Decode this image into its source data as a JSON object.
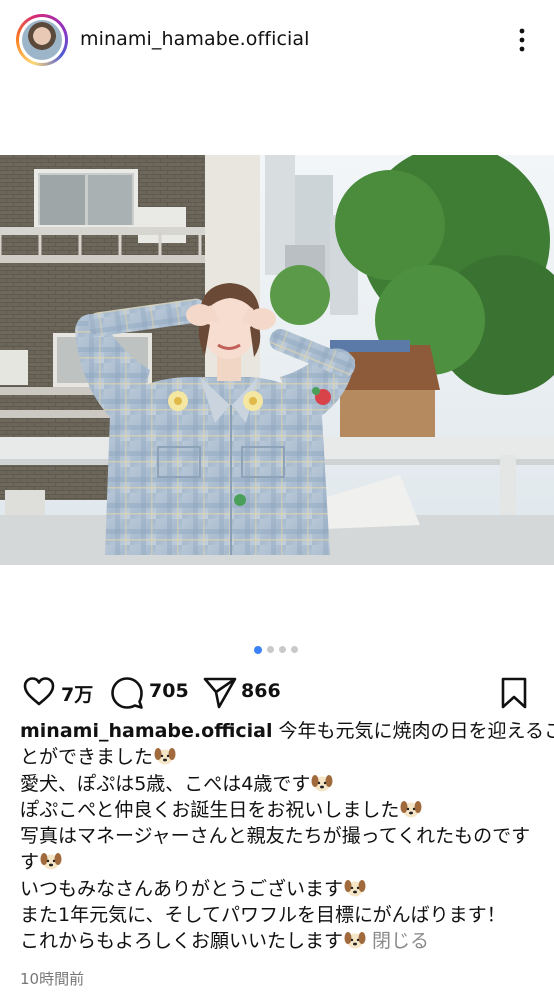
{
  "header": {
    "username": "minami_hamabe.official"
  },
  "carousel": {
    "total": 4,
    "active": 0
  },
  "actions": {
    "likes": "7万",
    "comments": "705",
    "shares": "866"
  },
  "caption": {
    "username": "minami_hamabe.official",
    "line1": "今年も元気に焼肉の日を迎えるこ",
    "line2": "とができました",
    "line3": "愛犬、ぽぷは5歳、こぺは4歳です",
    "line4": "ぽぷこぺと仲良くお誕生日をお祝いしました",
    "line5": "写真はマネージャーさんと親友たちが撮ってくれたものです",
    "line6": "す",
    "line7": "いつもみなさんありがとうございます",
    "line8": "また1年元気に、そしてパワフルを目標にがんばります！",
    "line9": "これからもよろしくお願いいたします",
    "close": "閉じる"
  },
  "timestamp": "10時間前",
  "icons": {
    "like": "heart-icon",
    "comment": "comment-icon",
    "share": "send-icon",
    "save": "bookmark-icon",
    "more": "more-vertical-icon",
    "emoji": "dog-face-emoji"
  }
}
